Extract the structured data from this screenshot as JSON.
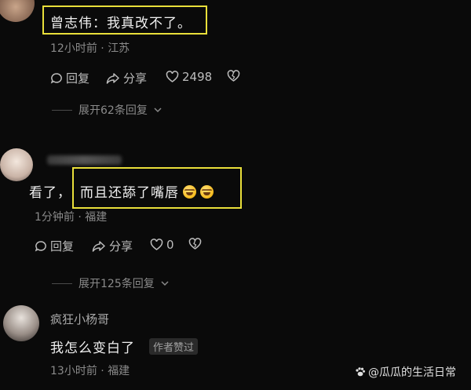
{
  "comments": [
    {
      "text": "曾志伟：我真改不了。",
      "time": "12小时前",
      "location": "江苏",
      "reply_label": "回复",
      "share_label": "分享",
      "likes": "2498"
    },
    {
      "text_prefix": "看了，",
      "text_highlight": "而且还舔了嘴唇",
      "time": "1分钟前",
      "location": "福建",
      "reply_label": "回复",
      "share_label": "分享",
      "likes": "0"
    },
    {
      "username": "疯狂小杨哥",
      "text": "我怎么变白了",
      "badge": "作者赞过",
      "time": "13小时前",
      "location": "福建"
    }
  ],
  "expand": [
    {
      "label": "展开62条回复"
    },
    {
      "label": "展开125条回复"
    }
  ],
  "separator": "·",
  "watermark": "@瓜瓜的生活日常",
  "colors": {
    "highlight": "#e9df3a",
    "background": "#0a0a0a"
  }
}
